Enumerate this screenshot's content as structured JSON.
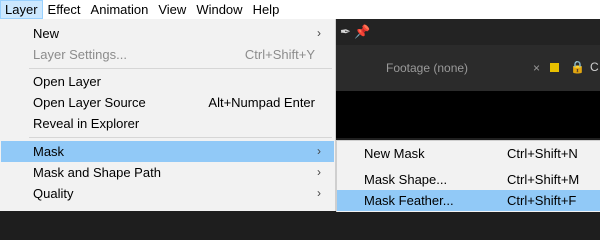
{
  "menubar": {
    "items": [
      "Layer",
      "Effect",
      "Animation",
      "View",
      "Window",
      "Help"
    ]
  },
  "layer_menu": {
    "items": [
      {
        "label": "New",
        "shortcut": "",
        "submenu": true,
        "disabled": false
      },
      {
        "label": "Layer Settings...",
        "shortcut": "Ctrl+Shift+Y",
        "submenu": false,
        "disabled": true
      },
      {
        "label": "Open Layer",
        "shortcut": "",
        "submenu": false,
        "disabled": false
      },
      {
        "label": "Open Layer Source",
        "shortcut": "Alt+Numpad Enter",
        "submenu": false,
        "disabled": false
      },
      {
        "label": "Reveal in Explorer",
        "shortcut": "",
        "submenu": false,
        "disabled": false
      },
      {
        "label": "Mask",
        "shortcut": "",
        "submenu": true,
        "disabled": false,
        "highlighted": true
      },
      {
        "label": "Mask and Shape Path",
        "shortcut": "",
        "submenu": true,
        "disabled": false
      },
      {
        "label": "Quality",
        "shortcut": "",
        "submenu": true,
        "disabled": false
      }
    ],
    "submenu_arrow": "›"
  },
  "mask_submenu": {
    "items": [
      {
        "label": "New Mask",
        "shortcut": "Ctrl+Shift+N"
      },
      {
        "label": "Mask Shape...",
        "shortcut": "Ctrl+Shift+M"
      },
      {
        "label": "Mask Feather...",
        "shortcut": "Ctrl+Shift+F",
        "highlighted": true
      }
    ]
  },
  "panel": {
    "footage_label": "Footage (none)",
    "close_glyph": "×",
    "lock_glyph": "🔒",
    "tab_letter": "C",
    "swatch_color": "#e8c000"
  },
  "colors": {
    "highlight": "#91c9f7",
    "menu_bg": "#f2f2f2",
    "menubar_active": "#cce8ff"
  }
}
